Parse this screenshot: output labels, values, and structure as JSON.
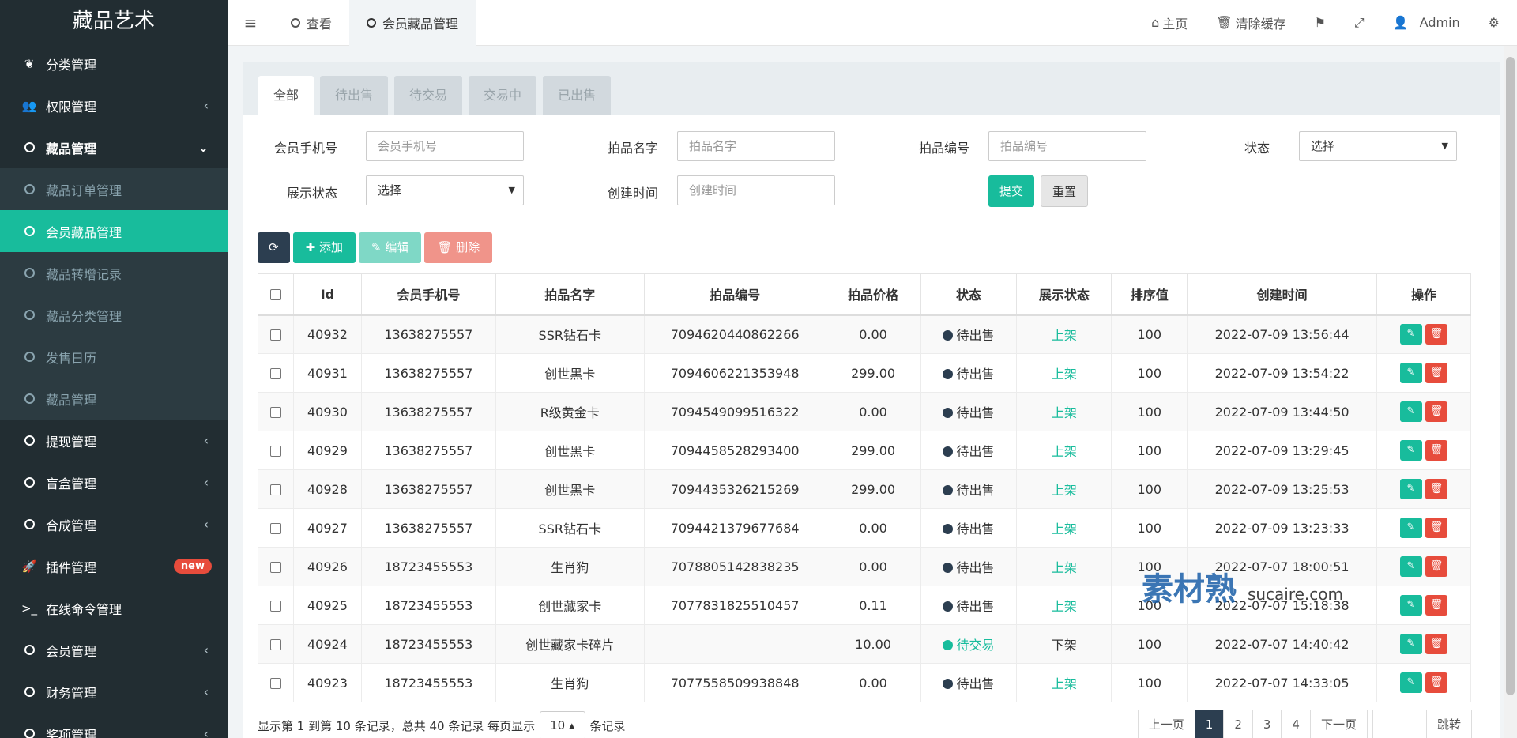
{
  "app": {
    "title": "藏品艺术"
  },
  "sidebar": {
    "items": [
      {
        "label": "分类管理",
        "icon": "leaf-icon"
      },
      {
        "label": "权限管理",
        "icon": "users-icon"
      },
      {
        "label": "藏品管理",
        "icon": "circle-icon"
      },
      {
        "label": "藏品订单管理"
      },
      {
        "label": "会员藏品管理"
      },
      {
        "label": "藏品转增记录"
      },
      {
        "label": "藏品分类管理"
      },
      {
        "label": "发售日历"
      },
      {
        "label": "藏品管理"
      },
      {
        "label": "提现管理"
      },
      {
        "label": "盲盒管理"
      },
      {
        "label": "合成管理"
      },
      {
        "label": "插件管理",
        "badge": "new"
      },
      {
        "label": "在线命令管理"
      },
      {
        "label": "会员管理"
      },
      {
        "label": "财务管理"
      },
      {
        "label": "奖项管理"
      }
    ]
  },
  "topbar": {
    "tabs": [
      "查看",
      "会员藏品管理"
    ],
    "home": "主页",
    "clear_cache": "清除缓存",
    "user": "Admin"
  },
  "status_tabs": [
    "全部",
    "待出售",
    "待交易",
    "交易中",
    "已出售"
  ],
  "filters": {
    "phone_label": "会员手机号",
    "phone_placeholder": "会员手机号",
    "name_label": "拍品名字",
    "name_placeholder": "拍品名字",
    "code_label": "拍品编号",
    "code_placeholder": "拍品编号",
    "status_label": "状态",
    "status_value": "选择",
    "display_label": "展示状态",
    "display_value": "选择",
    "created_label": "创建时间",
    "created_placeholder": "创建时间",
    "submit": "提交",
    "reset": "重置"
  },
  "toolbar": {
    "add": "添加",
    "edit": "编辑",
    "delete": "删除"
  },
  "table": {
    "headers": [
      "Id",
      "会员手机号",
      "拍品名字",
      "拍品编号",
      "拍品价格",
      "状态",
      "展示状态",
      "排序值",
      "创建时间",
      "操作"
    ],
    "rows": [
      {
        "id": "40932",
        "phone": "13638275557",
        "name": "SSR钻石卡",
        "code": "7094620440862266",
        "price": "0.00",
        "status": "待出售",
        "display": "上架",
        "sort": "100",
        "created": "2022-07-09 13:56:44"
      },
      {
        "id": "40931",
        "phone": "13638275557",
        "name": "创世黑卡",
        "code": "7094606221353948",
        "price": "299.00",
        "status": "待出售",
        "display": "上架",
        "sort": "100",
        "created": "2022-07-09 13:54:22"
      },
      {
        "id": "40930",
        "phone": "13638275557",
        "name": "R级黄金卡",
        "code": "7094549099516322",
        "price": "0.00",
        "status": "待出售",
        "display": "上架",
        "sort": "100",
        "created": "2022-07-09 13:44:50"
      },
      {
        "id": "40929",
        "phone": "13638275557",
        "name": "创世黑卡",
        "code": "7094458528293400",
        "price": "299.00",
        "status": "待出售",
        "display": "上架",
        "sort": "100",
        "created": "2022-07-09 13:29:45"
      },
      {
        "id": "40928",
        "phone": "13638275557",
        "name": "创世黑卡",
        "code": "7094435326215269",
        "price": "299.00",
        "status": "待出售",
        "display": "上架",
        "sort": "100",
        "created": "2022-07-09 13:25:53"
      },
      {
        "id": "40927",
        "phone": "13638275557",
        "name": "SSR钻石卡",
        "code": "7094421379677684",
        "price": "0.00",
        "status": "待出售",
        "display": "上架",
        "sort": "100",
        "created": "2022-07-09 13:23:33"
      },
      {
        "id": "40926",
        "phone": "18723455553",
        "name": "生肖狗",
        "code": "7078805142838235",
        "price": "0.00",
        "status": "待出售",
        "display": "上架",
        "sort": "100",
        "created": "2022-07-07 18:00:51"
      },
      {
        "id": "40925",
        "phone": "18723455553",
        "name": "创世藏家卡",
        "code": "7077831825510457",
        "price": "0.11",
        "status": "待出售",
        "display": "上架",
        "sort": "100",
        "created": "2022-07-07 15:18:38"
      },
      {
        "id": "40924",
        "phone": "18723455553",
        "name": "创世藏家卡碎片",
        "code": "",
        "price": "10.00",
        "status": "待交易",
        "display": "下架",
        "sort": "100",
        "created": "2022-07-07 14:40:42"
      },
      {
        "id": "40923",
        "phone": "18723455553",
        "name": "生肖狗",
        "code": "7077558509938848",
        "price": "0.00",
        "status": "待出售",
        "display": "上架",
        "sort": "100",
        "created": "2022-07-07 14:33:05"
      }
    ]
  },
  "footer": {
    "info": "显示第 1 到第 10 条记录，总共 40 条记录 每页显示",
    "page_size": "10",
    "suffix": "条记录",
    "prev": "上一页",
    "pages": [
      "1",
      "2",
      "3",
      "4"
    ],
    "next": "下一页",
    "go": "跳转"
  },
  "watermark": {
    "text": "素材熟",
    "url": "sucaire.com"
  },
  "colors": {
    "sidebar_bg": "#222d32",
    "accent": "#18bc9c",
    "dark": "#2c3e50",
    "danger": "#e74c3c"
  }
}
